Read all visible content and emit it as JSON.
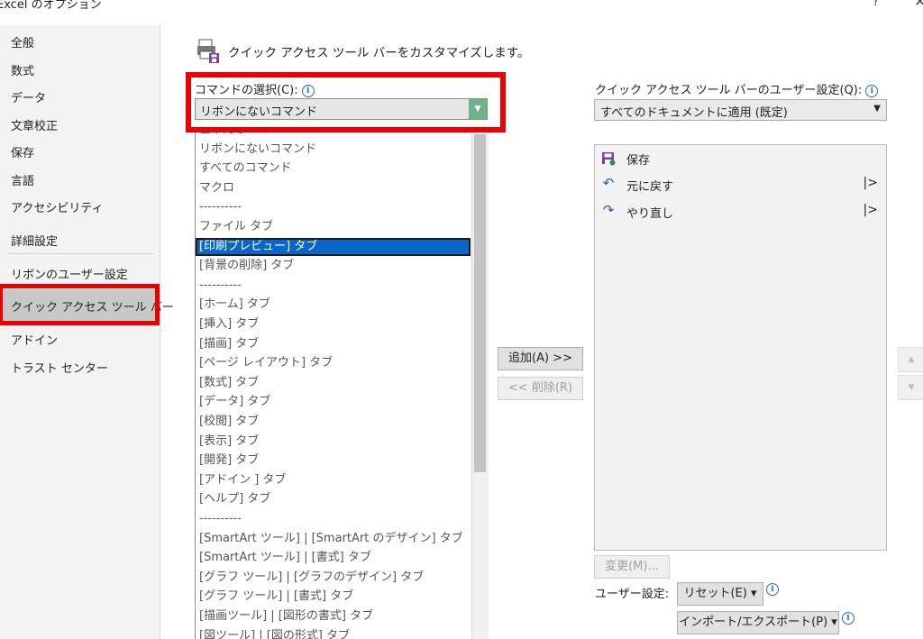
{
  "window": {
    "title": "Excel のオプション",
    "help_label": "?",
    "close_label": "✕"
  },
  "sidebar": {
    "items": [
      {
        "label": "全般"
      },
      {
        "label": "数式"
      },
      {
        "label": "データ"
      },
      {
        "label": "文章校正"
      },
      {
        "label": "保存"
      },
      {
        "label": "言語"
      },
      {
        "label": "アクセシビリティ"
      },
      {
        "label": "詳細設定"
      },
      {
        "label": "リボンのユーザー設定"
      },
      {
        "label": "クイック アクセス ツール バー"
      },
      {
        "label": "アドイン"
      },
      {
        "label": "トラスト センター"
      }
    ],
    "selected_index": 9
  },
  "header": {
    "title": "クイック アクセス ツール バーをカスタマイズします。",
    "icon": "qat-customize-icon"
  },
  "commands": {
    "label": "コマンドの選択(C):",
    "selected": "リボンにないコマンド",
    "options": [
      "基本的なコマンド",
      "リボンにないコマンド",
      "すべてのコマンド",
      "マクロ",
      "----------",
      "ファイル タブ",
      "[印刷プレビュー] タブ",
      "[背景の削除] タブ",
      "----------",
      "[ホーム] タブ",
      "[挿入] タブ",
      "[描画] タブ",
      "[ページ レイアウト] タブ",
      "[数式] タブ",
      "[データ] タブ",
      "[校閲] タブ",
      "[表示] タブ",
      "[開発] タブ",
      "[アドイン ] タブ",
      "[ヘルプ] タブ",
      "----------",
      "[SmartArt ツール] | [SmartArt のデザイン] タブ",
      "[SmartArt ツール] | [書式] タブ",
      "[グラフ ツール] | [グラフのデザイン] タブ",
      "[グラフ ツール] | [書式] タブ",
      "[描画ツール] | [図形の書式] タブ",
      "[図ツール] | [図の形式] タブ"
    ],
    "highlighted_index": 6
  },
  "buttons": {
    "add": "追加(A) >>",
    "remove": "<< 削除(R)",
    "modify": "変更(M)...",
    "reset": "リセット(E) ▾",
    "import_export": "インポート/エクスポート(P) ▾"
  },
  "qat": {
    "label": "クイック アクセス ツール バーのユーザー設定(Q):",
    "scope": "すべてのドキュメントに適用 (既定)",
    "items": [
      {
        "label": "保存",
        "icon": "save-icon",
        "has_submenu": false
      },
      {
        "label": "元に戻す",
        "icon": "undo-icon",
        "has_submenu": true
      },
      {
        "label": "やり直し",
        "icon": "redo-icon",
        "has_submenu": true
      }
    ],
    "user_settings_label": "ユーザー設定:"
  },
  "colors": {
    "highlight_red": "#ee0000",
    "selection_blue": "#0a66c8",
    "dropdown_green": "#6fb38a"
  }
}
